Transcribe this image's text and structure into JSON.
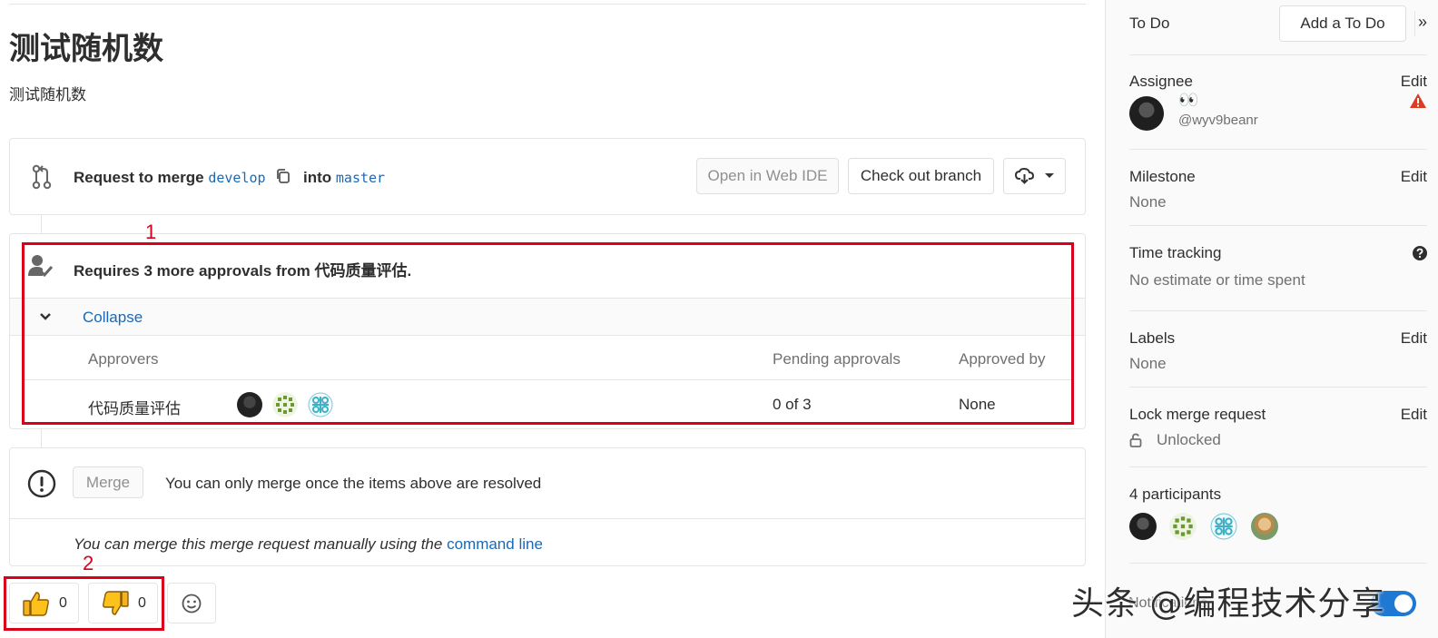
{
  "issue": {
    "title": "测试随机数",
    "description": "测试随机数"
  },
  "merge_request": {
    "prefix": "Request to merge",
    "source_branch": "develop",
    "into": "into",
    "target_branch": "master",
    "open_webide_label": "Open in Web IDE",
    "checkout_label": "Check out branch"
  },
  "approvals": {
    "summary": "Requires 3 more approvals from 代码质量评估.",
    "collapse_label": "Collapse",
    "headers": {
      "approvers": "Approvers",
      "pending": "Pending approvals",
      "approved_by": "Approved by"
    },
    "rows": [
      {
        "group": "代码质量评估",
        "pending": "0 of 3",
        "approved_by": "None"
      }
    ]
  },
  "mergebox": {
    "merge_label": "Merge",
    "message": "You can only merge once the items above are resolved",
    "manual_prefix": "You can merge this merge request manually using the",
    "manual_link": "command line"
  },
  "awards": {
    "thumbs_up_count": "0",
    "thumbs_down_count": "0"
  },
  "annotations": {
    "box1": "1",
    "box2": "2"
  },
  "sidebar": {
    "todo_label": "To Do",
    "add_todo_label": "Add a To Do",
    "collapse_icon": "»",
    "assignee": {
      "label": "Assignee",
      "edit": "Edit",
      "name": "👀",
      "handle": "@wyv9beanr"
    },
    "milestone": {
      "label": "Milestone",
      "edit": "Edit",
      "value": "None"
    },
    "time_tracking": {
      "label": "Time tracking",
      "value": "No estimate or time spent"
    },
    "labels": {
      "label": "Labels",
      "edit": "Edit",
      "value": "None"
    },
    "lock": {
      "label": "Lock merge request",
      "edit": "Edit",
      "value": "Unlocked"
    },
    "participants": {
      "label": "4 participants"
    },
    "notifications": {
      "label": "Notifications"
    }
  },
  "watermark": "头条 @编程技术分享",
  "colors": {
    "link": "#1b69b6",
    "annotation_red": "#d9001b",
    "warning_red": "#db3b21",
    "toggle_blue": "#1f78d1"
  }
}
